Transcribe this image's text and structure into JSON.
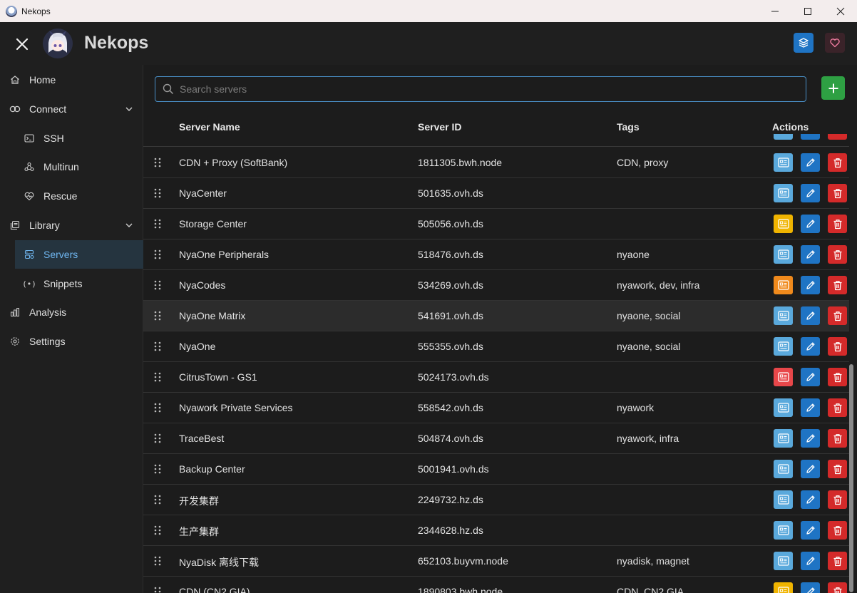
{
  "window": {
    "title": "Nekops"
  },
  "header": {
    "brand": "Nekops"
  },
  "sidebar": {
    "items": [
      {
        "label": "Home"
      },
      {
        "label": "Connect"
      },
      {
        "label": "SSH"
      },
      {
        "label": "Multirun"
      },
      {
        "label": "Rescue"
      },
      {
        "label": "Library"
      },
      {
        "label": "Servers"
      },
      {
        "label": "Snippets"
      },
      {
        "label": "Analysis"
      },
      {
        "label": "Settings"
      }
    ]
  },
  "search": {
    "placeholder": "Search servers",
    "value": ""
  },
  "table": {
    "headers": {
      "name": "Server Name",
      "id": "Server ID",
      "tags": "Tags",
      "actions": "Actions"
    },
    "rows": [
      {
        "name": "CDN + Proxy (SoftBank)",
        "id": "1811305.bwh.node",
        "tags": "CDN, proxy",
        "status_color": "#5aa9dc"
      },
      {
        "name": "NyaCenter",
        "id": "501635.ovh.ds",
        "tags": "",
        "status_color": "#5aa9dc"
      },
      {
        "name": "Storage Center",
        "id": "505056.ovh.ds",
        "tags": "",
        "status_color": "#f0b400"
      },
      {
        "name": "NyaOne Peripherals",
        "id": "518476.ovh.ds",
        "tags": "nyaone",
        "status_color": "#5aa9dc"
      },
      {
        "name": "NyaCodes",
        "id": "534269.ovh.ds",
        "tags": "nyawork, dev, infra",
        "status_color": "#f08a1c"
      },
      {
        "name": "NyaOne Matrix",
        "id": "541691.ovh.ds",
        "tags": "nyaone, social",
        "status_color": "#5aa9dc"
      },
      {
        "name": "NyaOne",
        "id": "555355.ovh.ds",
        "tags": "nyaone, social",
        "status_color": "#5aa9dc"
      },
      {
        "name": "CitrusTown - GS1",
        "id": "5024173.ovh.ds",
        "tags": "",
        "status_color": "#e8474a"
      },
      {
        "name": "Nyawork Private Services",
        "id": "558542.ovh.ds",
        "tags": "nyawork",
        "status_color": "#5aa9dc"
      },
      {
        "name": "TraceBest",
        "id": "504874.ovh.ds",
        "tags": "nyawork, infra",
        "status_color": "#5aa9dc"
      },
      {
        "name": "Backup Center",
        "id": "5001941.ovh.ds",
        "tags": "",
        "status_color": "#5aa9dc"
      },
      {
        "name": "开发集群",
        "id": "2249732.hz.ds",
        "tags": "",
        "status_color": "#5aa9dc"
      },
      {
        "name": "生产集群",
        "id": "2344628.hz.ds",
        "tags": "",
        "status_color": "#5aa9dc"
      },
      {
        "name": "NyaDisk 离线下载",
        "id": "652103.buyvm.node",
        "tags": "nyadisk, magnet",
        "status_color": "#5aa9dc"
      },
      {
        "name": "CDN (CN2 GIA)",
        "id": "1890803.bwh.node",
        "tags": "CDN, CN2 GIA",
        "status_color": "#f0b400"
      }
    ]
  },
  "colors": {
    "accent": "#4a90c8",
    "add": "#2ea043",
    "edit": "#1f74c4",
    "delete": "#d42a2a",
    "active_nav": "#6fb6f0"
  }
}
